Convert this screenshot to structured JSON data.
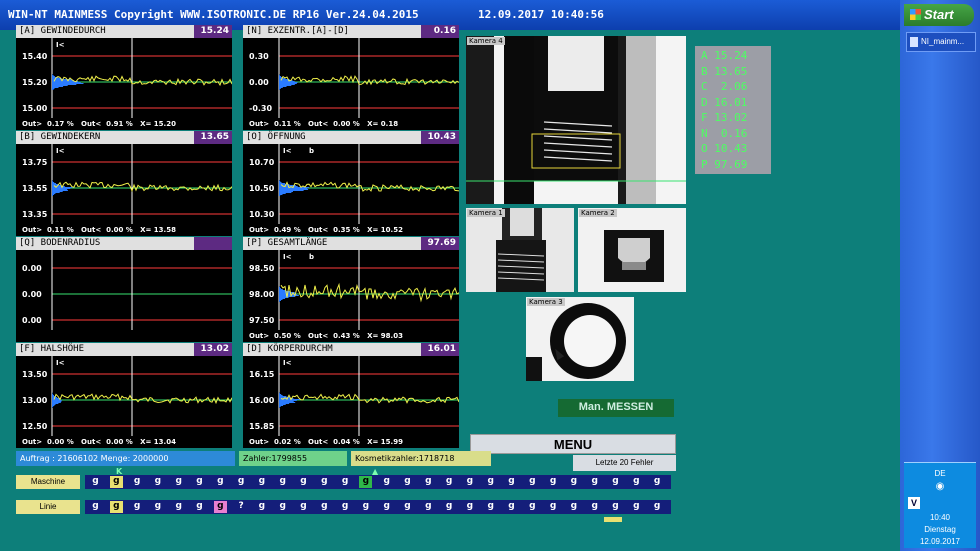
{
  "window": {
    "title": "WIN-NT MAINMESS Copyright WWW.ISOTRONIC.DE  RP16  Ver.24.04.2015",
    "datetime": "12.09.2017  10:40:56"
  },
  "taskbar": {
    "start_label": "Start",
    "task_label": "NI_mainm...",
    "tray_lang": "DE",
    "tray_time": "10:40",
    "tray_day": "Dienstag",
    "tray_date": "12.09.2017"
  },
  "colors": {
    "background": "#0d7f7a",
    "limit_line": "#ff3b3b",
    "signal": "#f0f04a",
    "target": "#39e26f",
    "histogram": "#2a7bff"
  },
  "panels": [
    {
      "title": "[A] GEWINDEDURCH",
      "value": "15.24",
      "y_labels": [
        "15.40",
        "15.20",
        "15.00"
      ],
      "footer": "Out>  0.17 %   Out<  0.91 %   X= 15.20",
      "has_signal": true,
      "hist": "big",
      "tags": [
        "I<"
      ]
    },
    {
      "title": "[N] EXZENTR.[A]-[D]",
      "value": "0.16",
      "y_labels": [
        "0.30",
        "0.00",
        "-0.30"
      ],
      "footer": "Out>  0.11 %   Out<  0.00 %   X= 0.18",
      "has_signal": true,
      "hist": "small",
      "tags": []
    },
    {
      "title": "[B] GEWINDEKERN",
      "value": "13.65",
      "y_labels": [
        "13.75",
        "13.55",
        "13.35"
      ],
      "footer": "Out>  0.11 %   Out<  0.00 %   X= 13.58",
      "has_signal": true,
      "hist": "small",
      "tags": [
        "I<"
      ]
    },
    {
      "title": "[O] ÖFFNUNG",
      "value": "10.43",
      "y_labels": [
        "10.70",
        "10.50",
        "10.30"
      ],
      "footer": "Out>  0.49 %   Out<  0.35 %   X= 10.52",
      "has_signal": true,
      "hist": "big",
      "tags": [
        "I<",
        "b"
      ]
    },
    {
      "title": "[Q] BODENRADIUS",
      "value": "",
      "y_labels": [
        "0.00",
        "0.00",
        "0.00"
      ],
      "footer": "",
      "has_signal": false,
      "hist": "none",
      "tags": []
    },
    {
      "title": "[P] GESAMTLÄNGE",
      "value": "97.69",
      "y_labels": [
        "98.50",
        "98.00",
        "97.50"
      ],
      "footer": "Out>  0.50 %   Out<  0.43 %   X= 98.03",
      "has_signal": true,
      "hist": "small",
      "tags": [
        "I<",
        "b"
      ]
    },
    {
      "title": "[F] HALSHÖHE",
      "value": "13.02",
      "y_labels": [
        "13.50",
        "13.00",
        "12.50"
      ],
      "footer": "Out>  0.00 %   Out<  0.00 %   X= 13.04",
      "has_signal": true,
      "hist": "flat",
      "tags": [
        "I<"
      ]
    },
    {
      "title": "[D] KÖRPERDURCHM",
      "value": "16.01",
      "y_labels": [
        "16.15",
        "16.00",
        "15.85"
      ],
      "footer": "Out>  0.02 %   Out<  0.04 %   X= 15.99",
      "has_signal": true,
      "hist": "small",
      "tags": [
        "I<"
      ]
    }
  ],
  "cameras": {
    "main_label": "Kamera 4",
    "cam1_label": "Kamera 1",
    "cam2_label": "Kamera 2",
    "cam3_label": "Kamera 3"
  },
  "measurements": "A 15.24\nB 13.65\nC  2.06\nD 16.01\nF 13.02\nN  0.16\nO 10.43\nP 97.69",
  "buttons": {
    "man_messen": "Man. MESSEN",
    "menu": "MENU",
    "letzte_fehler": "Letzte 20 Fehler"
  },
  "status": {
    "auftrag": "Auftrag :   21606102   Menge: 2000000",
    "zahler": "Zahler:1799855",
    "kosmetik": "Kosmetikzahler:1718718"
  },
  "rows": [
    {
      "label": "Maschine",
      "cells": [
        "g",
        "g",
        "g",
        "g",
        "g",
        "g",
        "g",
        "g",
        "g",
        "g",
        "g",
        "g",
        "g",
        "g",
        "g",
        "g",
        "g",
        "g",
        "g",
        "g",
        "g",
        "g",
        "g",
        "g",
        "g",
        "g",
        "g",
        "g"
      ],
      "highlights": {
        "1": "yellow",
        "13": "green"
      },
      "marker": "K"
    },
    {
      "label": "Linie",
      "cells": [
        "g",
        "g",
        "g",
        "g",
        "g",
        "g",
        "g",
        "?",
        "g",
        "g",
        "g",
        "g",
        "g",
        "g",
        "g",
        "g",
        "g",
        "g",
        "g",
        "g",
        "g",
        "g",
        "g",
        "g",
        "g",
        "g",
        "g",
        "g"
      ],
      "highlights": {
        "1": "yellow",
        "6": "pink"
      },
      "marker": ""
    }
  ]
}
